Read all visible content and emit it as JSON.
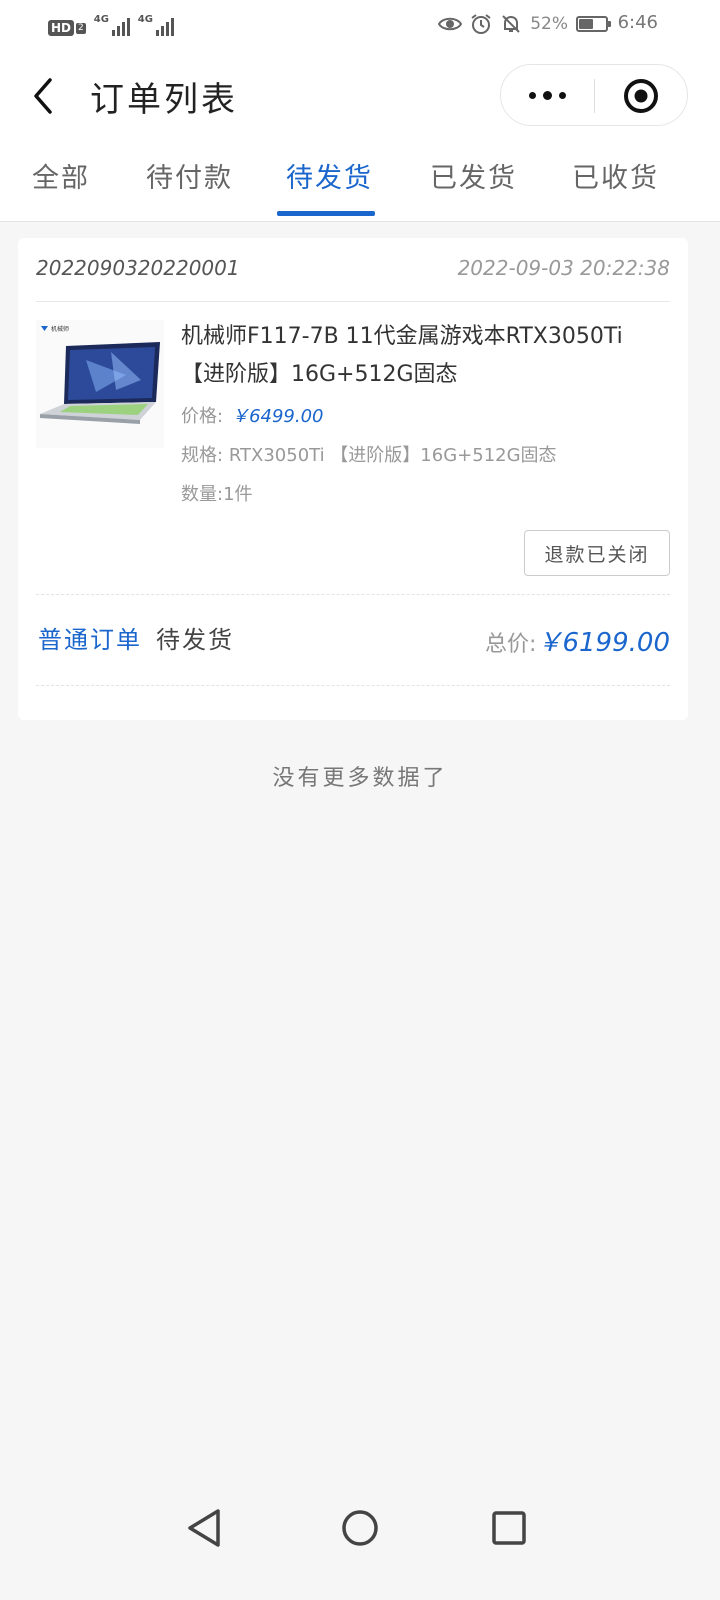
{
  "status_bar": {
    "hd_label": "HD",
    "hd_sub": "2",
    "signal1_label": "4G",
    "signal2_label": "4G",
    "battery_percent": "52%",
    "battery_level": 0.52,
    "time": "6:46"
  },
  "header": {
    "title": "订单列表"
  },
  "tabs": [
    {
      "label": "全部"
    },
    {
      "label": "待付款"
    },
    {
      "label": "待发货"
    },
    {
      "label": "已发货"
    },
    {
      "label": "已收货"
    }
  ],
  "active_tab": "待发货",
  "order": {
    "order_no": "2022090320220001",
    "time": "2022-09-03 20:22:38",
    "product": {
      "name": "机械师F117-7B 11代金属游戏本RTX3050Ti 【进阶版】16G+512G固态",
      "thumb_brand": "机械师",
      "price_label": "价格:",
      "price": "￥6499.00",
      "spec_label": "规格:",
      "spec": "RTX3050Ti 【进阶版】16G+512G固态",
      "qty_label": "数量:",
      "qty": "1件"
    },
    "refund_button": "退款已关闭",
    "type": "普通订单",
    "status": "待发货",
    "total_label": "总价:",
    "total": "￥6199.00"
  },
  "footer_message": "没有更多数据了",
  "colors": {
    "accent": "#1a66cc",
    "background": "#f6f6f6",
    "card": "#ffffff"
  },
  "icons": {
    "back": "chevron-left-icon",
    "more": "more-dots-icon",
    "close": "target-close-icon",
    "nav_back": "triangle-back-icon",
    "nav_home": "circle-home-icon",
    "nav_recent": "square-recent-icon"
  }
}
